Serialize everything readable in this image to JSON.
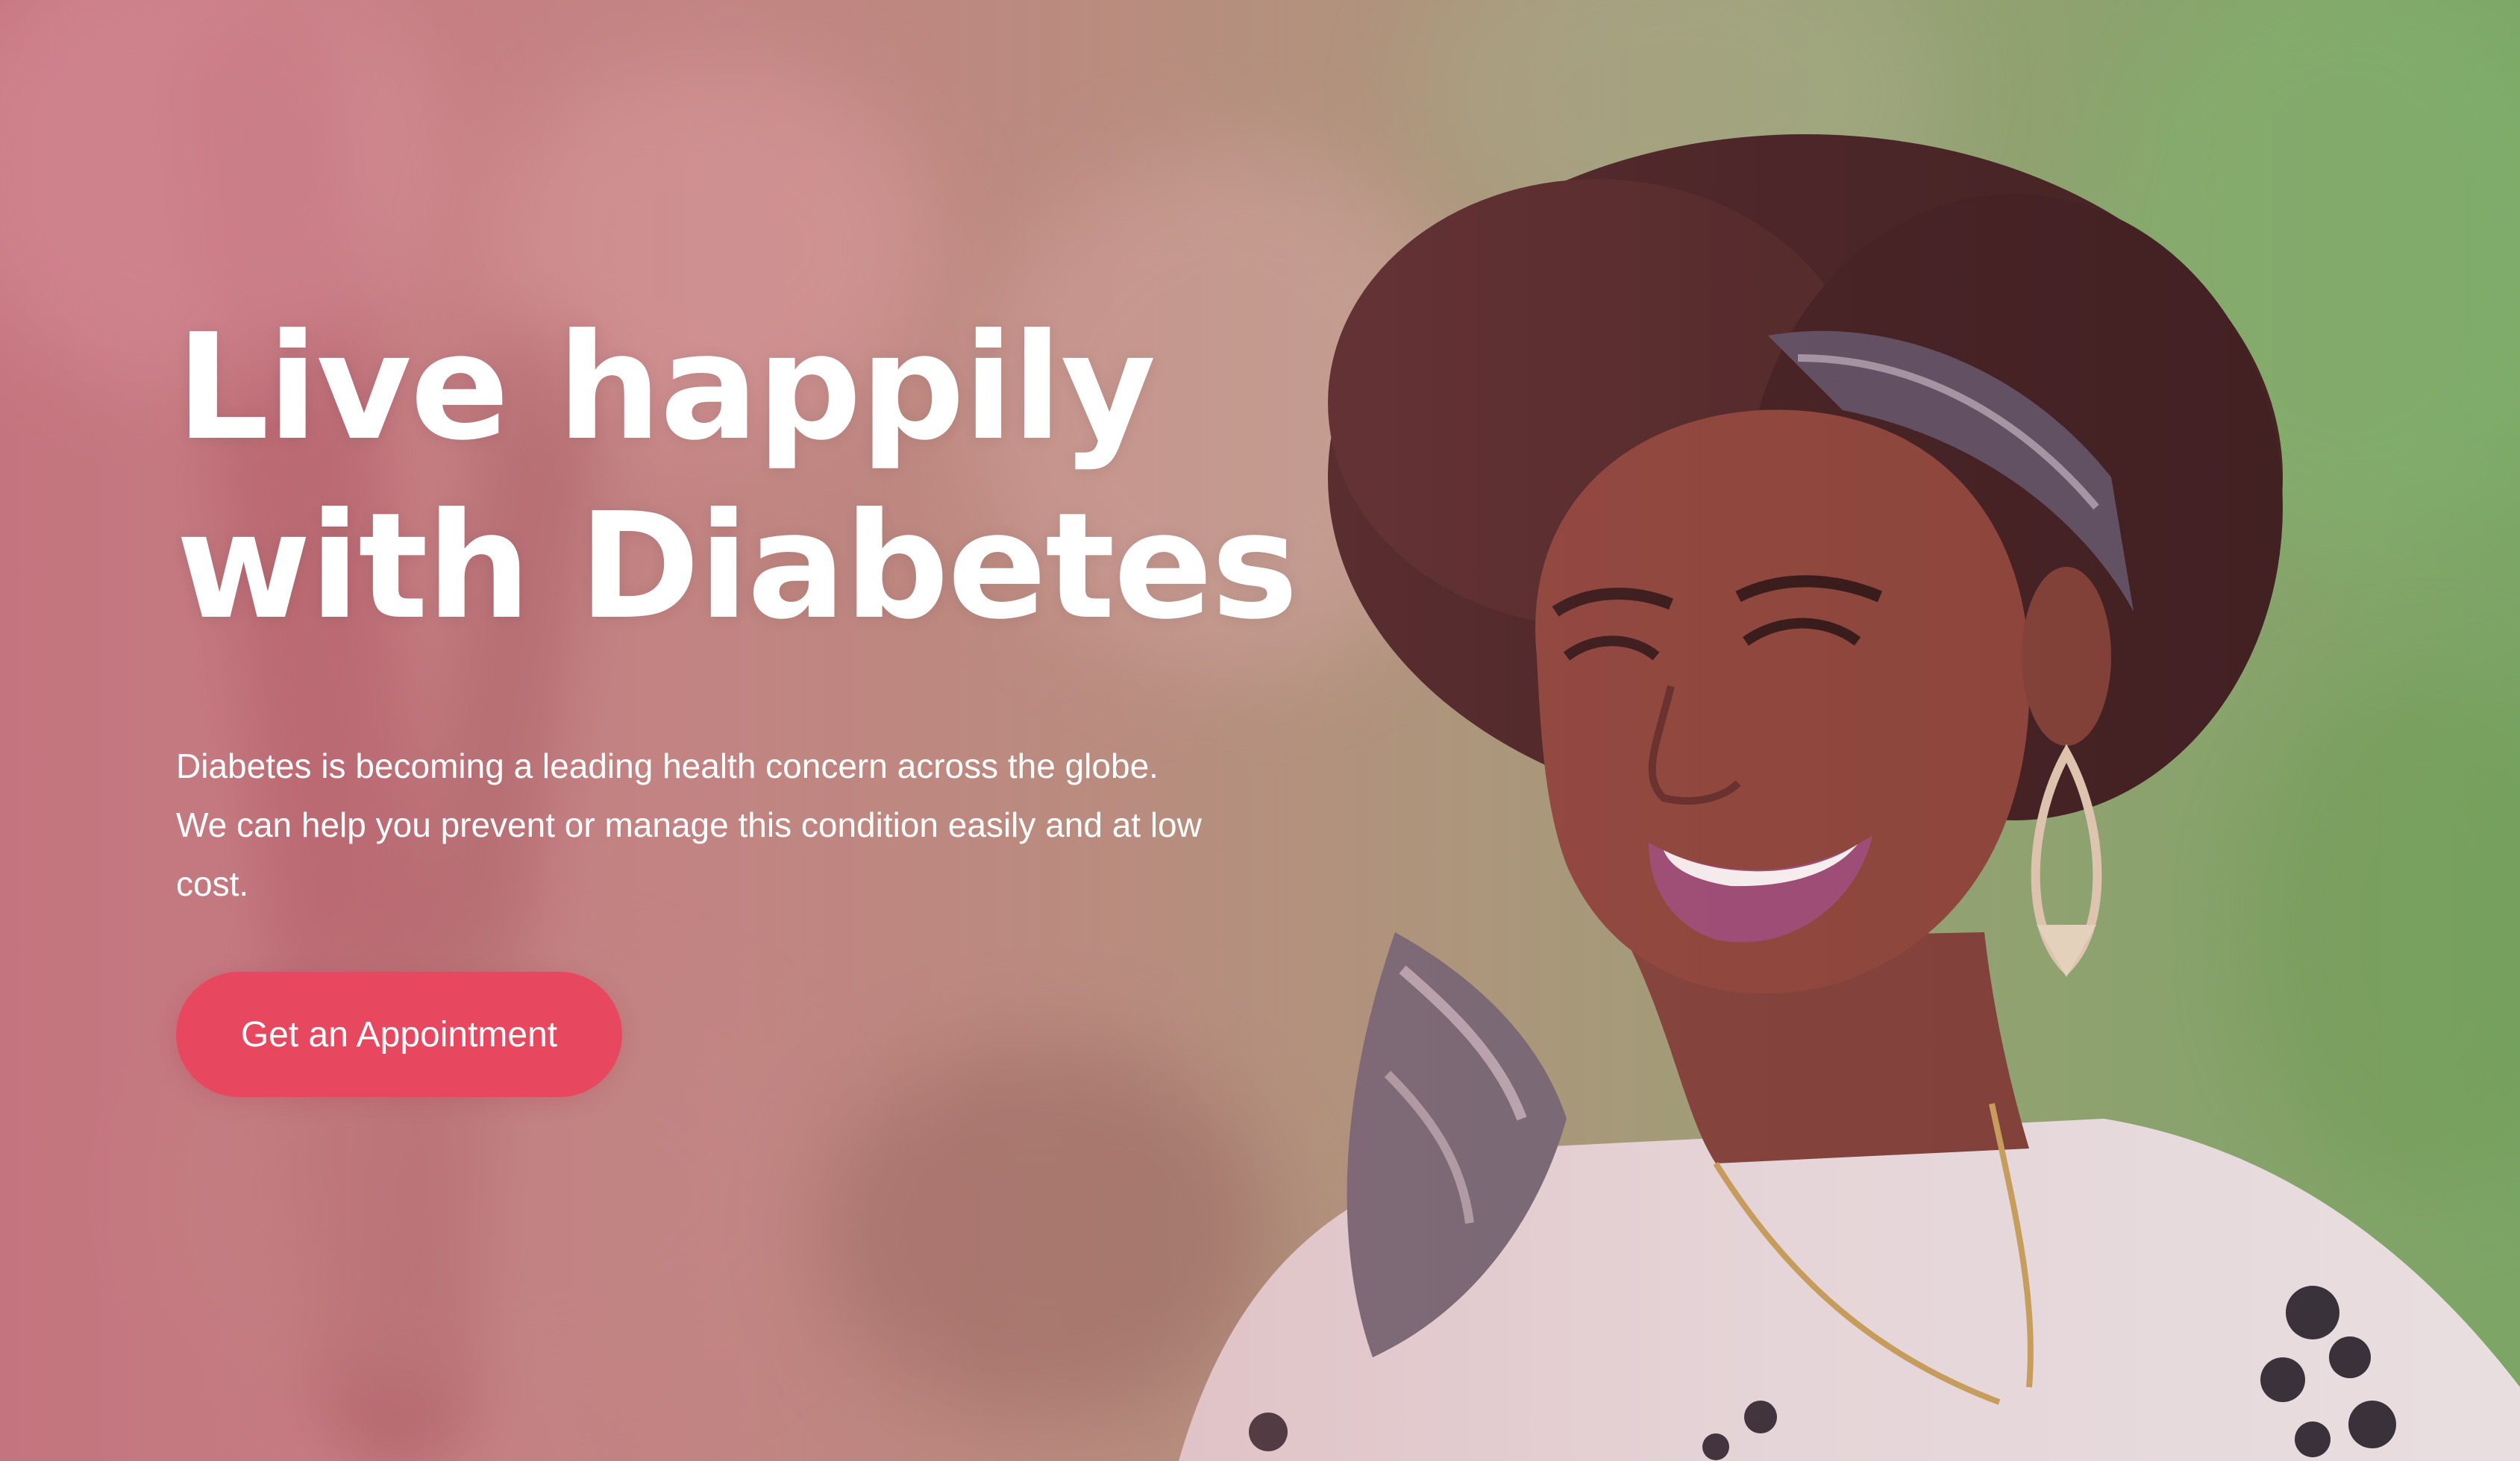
{
  "hero": {
    "headline_line1": "Live happily",
    "headline_line2": "with Diabetes",
    "description": "Diabetes is becoming a leading health concern across the globe. We can help you prevent or manage this condition easily and at low cost.",
    "cta_label": "Get an Appointment",
    "image_alt": "Smiling woman with curly hair and patterned headband outdoors"
  },
  "colors": {
    "accent": "#e8485f",
    "text": "#ffffff"
  }
}
